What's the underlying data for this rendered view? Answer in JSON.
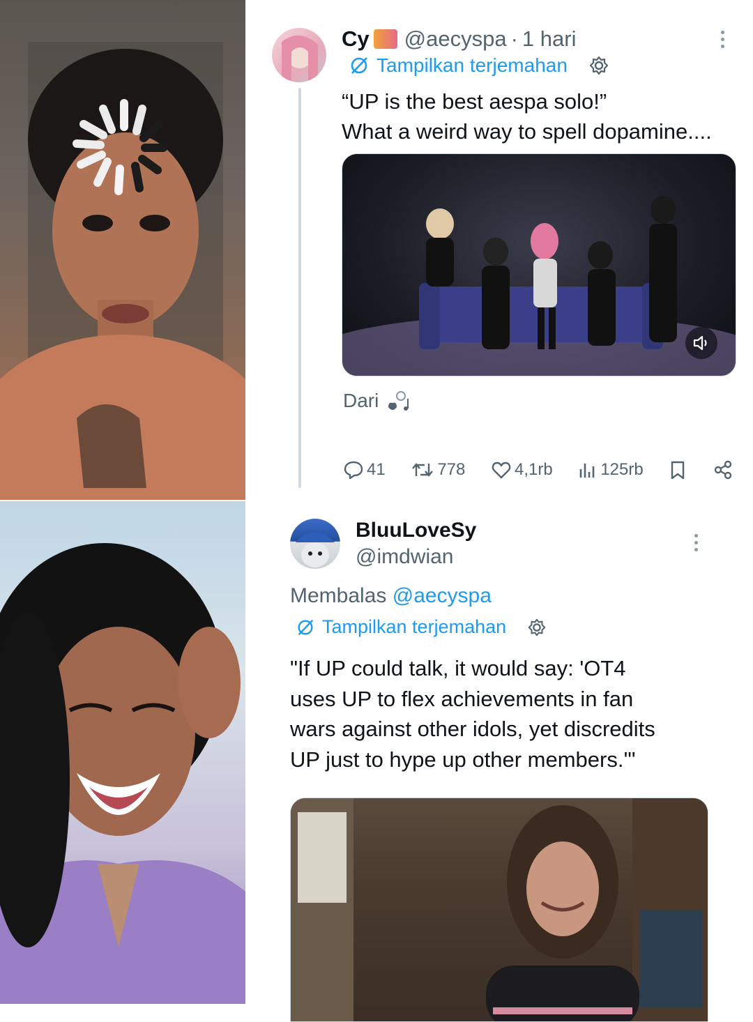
{
  "tweet1": {
    "author_name": "Cy",
    "handle": "@aecyspa",
    "dot": "·",
    "time": "1 hari",
    "translate_label": "Tampilkan terjemahan",
    "text": "“UP is the best aespa solo!”\nWhat a weird way to spell dopamine....",
    "dari_label": "Dari",
    "actions": {
      "replies": "41",
      "retweets": "778",
      "likes": "4,1rb",
      "views": "125rb"
    }
  },
  "tweet2": {
    "author_name": "BluuLoveSy",
    "handle": "@imdwian",
    "reply_prefix": "Membalas",
    "reply_mention": "@aecyspa",
    "translate_label": "Tampilkan terjemahan",
    "text": "\"If UP could talk, it would say: 'OT4\nuses UP to flex achievements in fan\nwars against other idols, yet discredits\nUP just to hype up other members.'\""
  },
  "colors": {
    "accent": "#1d9bf0",
    "secondary_text": "#536471",
    "primary_text": "#0f1419",
    "thread_line": "#cfd9de"
  },
  "icons": [
    "translate-icon",
    "gear-icon",
    "more-icon",
    "reply-icon",
    "retweet-icon",
    "like-icon",
    "views-icon",
    "bookmark-icon",
    "share-icon",
    "sound-icon"
  ]
}
